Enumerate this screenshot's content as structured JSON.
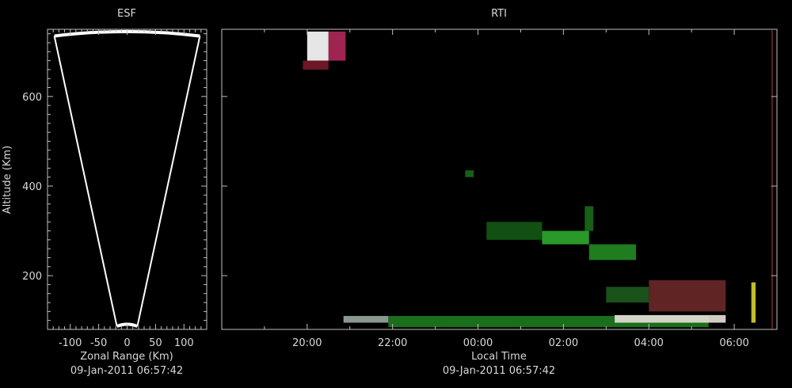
{
  "chart_data": [
    {
      "type": "scatter",
      "title": "ESF",
      "xlabel": "Zonal Range (Km)",
      "ylabel": "Altitude (Km)",
      "timestamp": "09-Jan-2011 06:57:42",
      "xlim": [
        -140,
        140
      ],
      "ylim": [
        80,
        750
      ],
      "xticks": [
        -100,
        -50,
        0,
        50,
        100
      ],
      "xtick_labels": [
        "-100",
        "-50",
        "0",
        "50",
        "100"
      ],
      "yticks": [
        200,
        400,
        600
      ],
      "ytick_labels": [
        "200",
        "400",
        "600"
      ],
      "beam_sector": {
        "edges": [
          {
            "x": [
              -128,
              -18
            ],
            "y": [
              735,
              87
            ]
          },
          {
            "x": [
              128,
              18
            ],
            "y": [
              735,
              87
            ]
          }
        ],
        "outer_arc_altitude": 745,
        "inner_arc_altitude": 87
      },
      "color": "#ffffff"
    },
    {
      "type": "heatmap",
      "title": "RTI",
      "xlabel": "Local Time",
      "timestamp": "09-Jan-2011 06:57:42",
      "ylim": [
        80,
        750
      ],
      "yticks": [
        200,
        400,
        600
      ],
      "xtick_labels": [
        "20:00",
        "22:00",
        "00:00",
        "02:00",
        "04:00",
        "06:00"
      ],
      "x_hours_range": [
        18.0,
        31.0
      ],
      "xtick_hours": [
        20,
        22,
        24,
        26,
        28,
        30
      ],
      "echo_regions": [
        {
          "t_start": 20.0,
          "t_end": 20.5,
          "alt_min": 680,
          "alt_max": 745,
          "color": "#ffffff"
        },
        {
          "t_start": 20.5,
          "t_end": 20.9,
          "alt_min": 680,
          "alt_max": 745,
          "color": "#b0285a"
        },
        {
          "t_start": 19.9,
          "t_end": 20.5,
          "alt_min": 660,
          "alt_max": 680,
          "color": "#7a1a2a"
        },
        {
          "t_start": 20.85,
          "t_end": 21.9,
          "alt_min": 95,
          "alt_max": 110,
          "color": "#9aa8a0"
        },
        {
          "t_start": 21.9,
          "t_end": 29.4,
          "alt_min": 85,
          "alt_max": 110,
          "color": "#1e7a1e"
        },
        {
          "t_start": 27.2,
          "t_end": 29.8,
          "alt_min": 95,
          "alt_max": 112,
          "color": "#e8e0da"
        },
        {
          "t_start": 28.0,
          "t_end": 29.8,
          "alt_min": 120,
          "alt_max": 190,
          "color": "#6a2828"
        },
        {
          "t_start": 27.0,
          "t_end": 28.0,
          "alt_min": 140,
          "alt_max": 175,
          "color": "#1e5a1e"
        },
        {
          "t_start": 25.5,
          "t_end": 26.6,
          "alt_min": 270,
          "alt_max": 300,
          "color": "#2eaa2e"
        },
        {
          "t_start": 26.6,
          "t_end": 27.7,
          "alt_min": 235,
          "alt_max": 270,
          "color": "#228a22"
        },
        {
          "t_start": 26.5,
          "t_end": 26.7,
          "alt_min": 300,
          "alt_max": 355,
          "color": "#1a6a1a"
        },
        {
          "t_start": 24.2,
          "t_end": 25.5,
          "alt_min": 280,
          "alt_max": 320,
          "color": "#145814"
        },
        {
          "t_start": 23.7,
          "t_end": 23.9,
          "alt_min": 420,
          "alt_max": 435,
          "color": "#1a6a1a"
        },
        {
          "t_start": 30.4,
          "t_end": 30.5,
          "alt_min": 95,
          "alt_max": 185,
          "color": "#d8d030"
        }
      ]
    }
  ]
}
